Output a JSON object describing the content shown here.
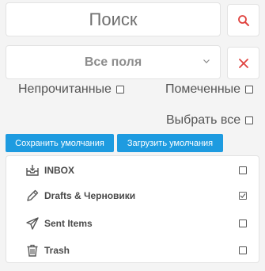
{
  "search": {
    "placeholder": "Поиск"
  },
  "field_select": {
    "selected": "Все поля"
  },
  "filters": {
    "unread_label": "Непрочитанные",
    "flagged_label": "Помеченные",
    "select_all_label": "Выбрать все"
  },
  "buttons": {
    "save_defaults": "Сохранить умолчания",
    "load_defaults": "Загрузить умолчания"
  },
  "folders": [
    {
      "label": "INBOX",
      "icon": "inbox-icon",
      "checked": false
    },
    {
      "label": "Drafts & Черновики",
      "icon": "pencil-icon",
      "checked": true
    },
    {
      "label": "Sent Items",
      "icon": "paper-plane-icon",
      "checked": false
    },
    {
      "label": "Trash",
      "icon": "trash-icon",
      "checked": false
    }
  ],
  "colors": {
    "accent_blue": "#1e9be0",
    "danger_red": "#e0433f",
    "background": "#f4f4f4"
  }
}
